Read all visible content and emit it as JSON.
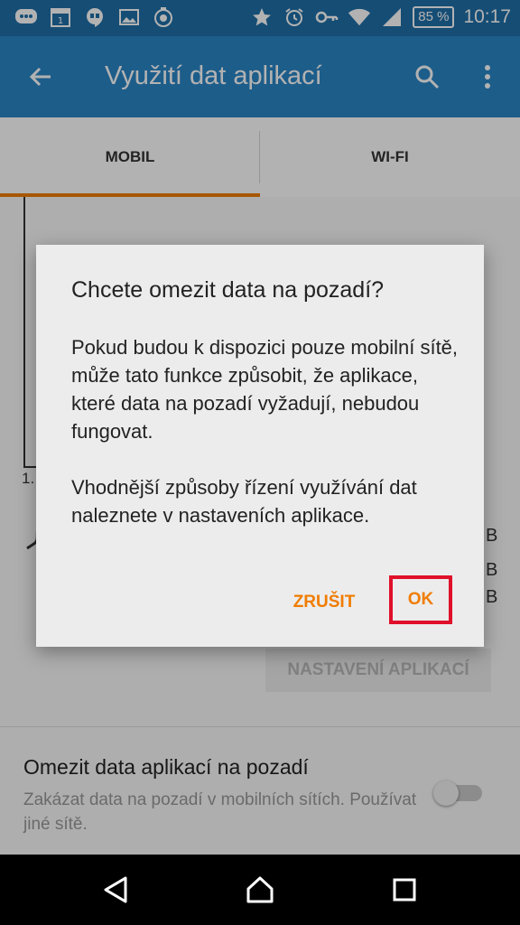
{
  "status_bar": {
    "battery": "85 %",
    "time": "10:17",
    "left_icons": [
      "chat-bubbles-icon",
      "calendar-icon",
      "hangouts-icon",
      "gallery-icon",
      "backup-icon"
    ],
    "right_icons": [
      "star-icon",
      "alarm-icon",
      "key-icon",
      "wifi-icon",
      "cellular-signal-icon",
      "battery-icon"
    ]
  },
  "app_bar": {
    "title": "Využití dat aplikací",
    "back_icon": "arrow-back-icon",
    "search_icon": "search-icon",
    "more_icon": "more-vert-icon"
  },
  "tabs": [
    {
      "label": "MOBIL",
      "active": true
    },
    {
      "label": "WI-FI",
      "active": false
    }
  ],
  "background": {
    "chart_label": "1.",
    "units": [
      "B",
      "B",
      "B"
    ],
    "settings_button": "NASTAVENÍ APLIKACÍ",
    "pref_title": "Omezit data aplikací na pozadí",
    "pref_subtitle": "Zakázat data na pozadí v mobilních sítích. Používat jiné sítě.",
    "toggle_on": false
  },
  "dialog": {
    "title": "Chcete omezit data na pozadí?",
    "paragraph1": "Pokud budou k dispozici pouze mobilní sítě, může tato funkce způsobit, že aplikace, které data na pozadí vyžadují, nebudou fungovat.",
    "paragraph2": "Vhodnější způsoby řízení využívání dat naleznete v nastaveních aplikace.",
    "cancel_label": "ZRUŠIT",
    "ok_label": "OK"
  },
  "colors": {
    "status_bar": "#1f6fa8",
    "app_bar": "#2a86c6",
    "accent": "#f07d00",
    "highlight": "#e0102a"
  }
}
